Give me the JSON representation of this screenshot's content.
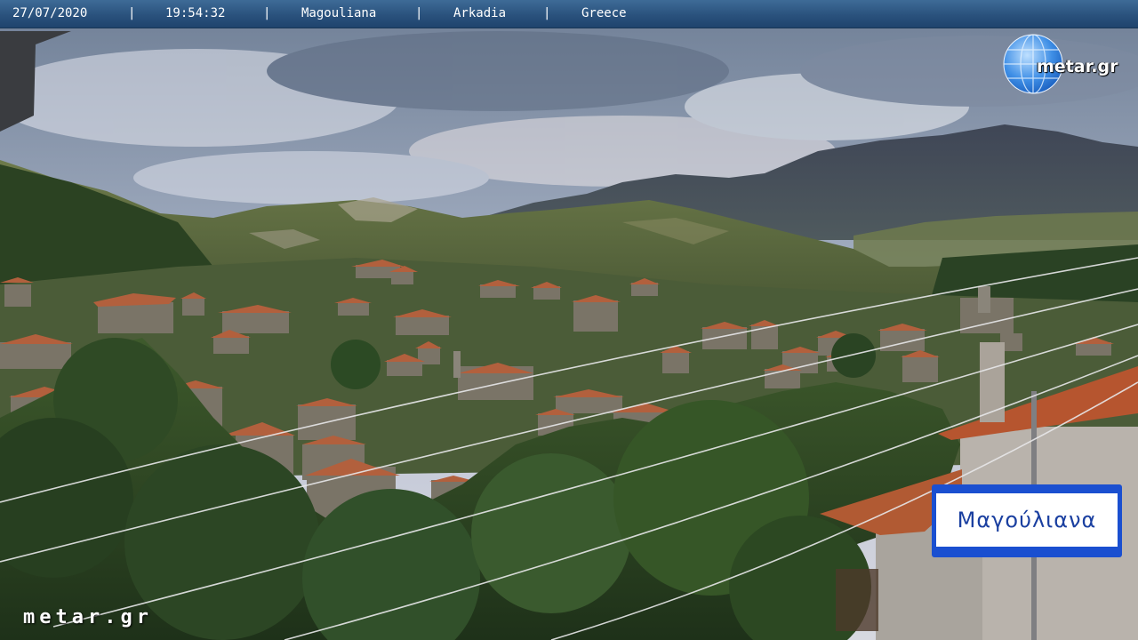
{
  "overlay": {
    "date": "27/07/2020",
    "time": "19:54:32",
    "village": "Magouliana",
    "region": "Arkadia",
    "country": "Greece",
    "separator": "|"
  },
  "logo": {
    "text": "metar.gr",
    "icon": "globe-icon"
  },
  "watermark": {
    "text": "metar.gr"
  },
  "street_sign": {
    "text": "Μαγούλιανα"
  },
  "colors": {
    "bar": "#2a527d",
    "sign_blue": "#1a4fd0"
  }
}
